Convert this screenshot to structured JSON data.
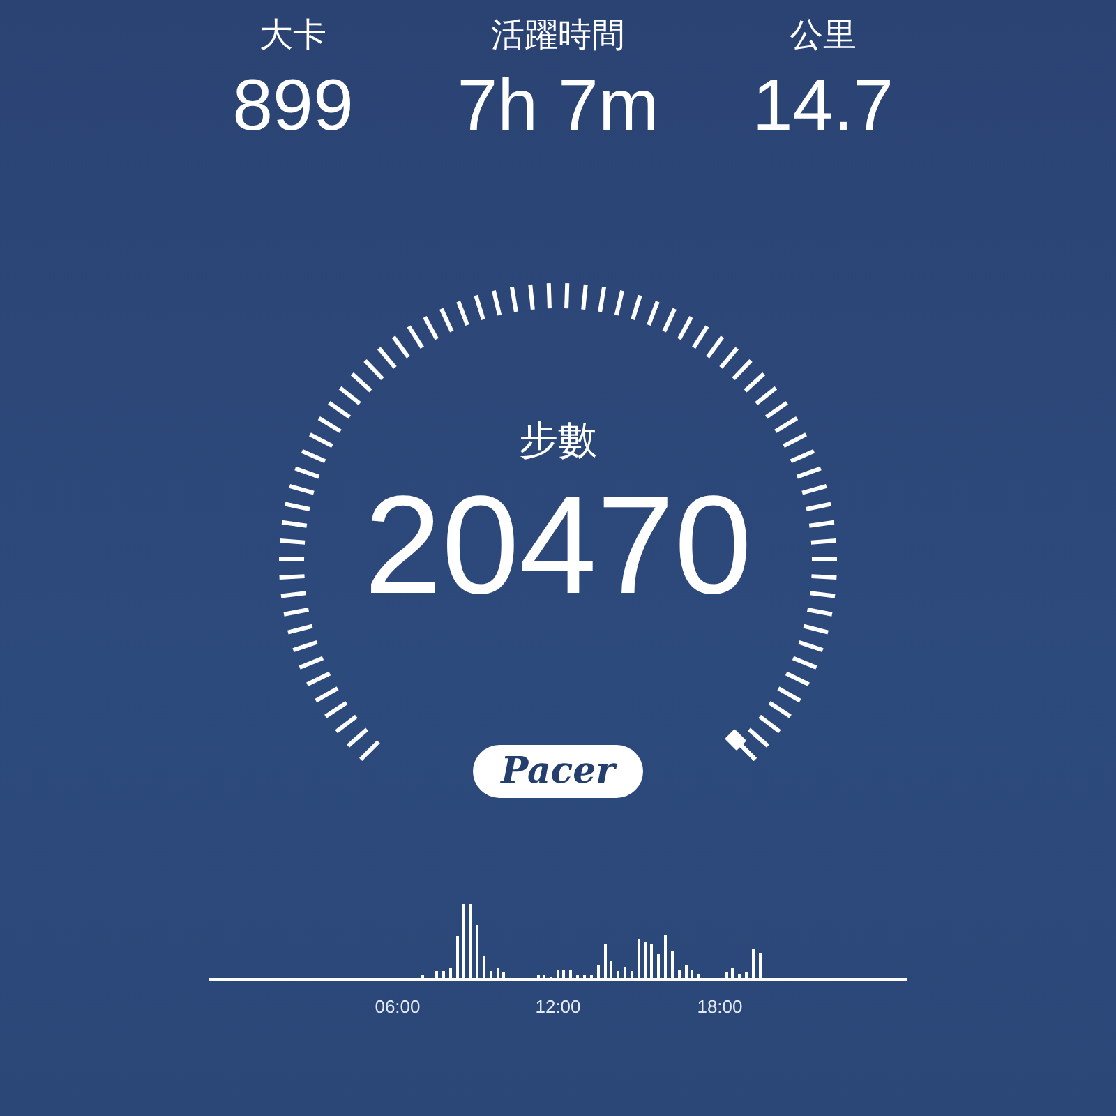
{
  "stats": [
    {
      "label": "大卡",
      "value": "899"
    },
    {
      "label": "活躍時間",
      "value": "7h 7m"
    },
    {
      "label": "公里",
      "value": "14.7"
    }
  ],
  "gauge": {
    "label": "步數",
    "value": "20470"
  },
  "logo": "Pacer",
  "activity_chart": {
    "time_labels": [
      "06:00",
      "12:00",
      "18:00"
    ]
  }
}
